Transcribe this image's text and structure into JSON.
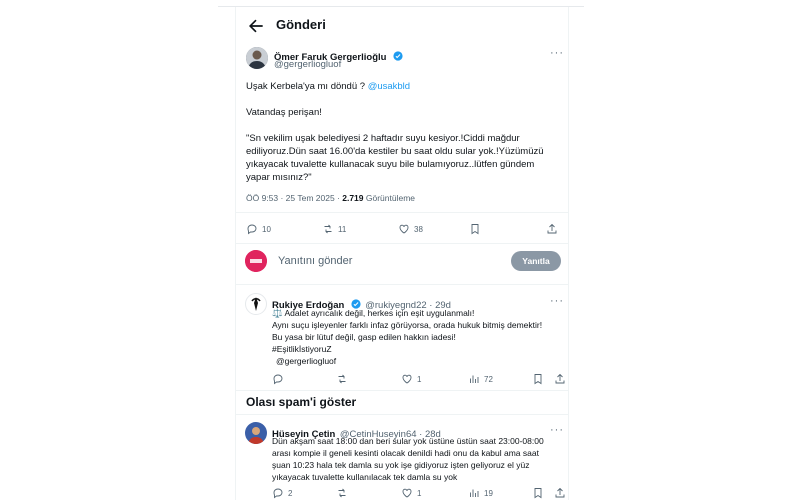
{
  "header": {
    "title": "Gönderi"
  },
  "tweet": {
    "author_name": "Ömer Faruk Gergerlioğlu",
    "author_handle": "@gergerliogluof",
    "line1_text": "Uşak Kerbela'ya mı döndü ? ",
    "line1_mention": "@usakbld",
    "line2": "Vatandaş perişan!",
    "quote_lines": [
      "\"Sn vekilim uşak belediyesi 2 haftadır suyu kesiyor.!Ciddi mağdur",
      "ediliyoruz.Dün saat 16.00'da kestiler bu saat oldu sular yok.!Yüzümüzü",
      "yıkayacak tuvalette kullanacak suyu bile bulamıyoruz..lütfen gündem",
      "yapar mısınız?\""
    ],
    "time": "ÖÖ 9:53 · 25 Tem 2025 · ",
    "views_count": "2.719",
    "views_label": " Görüntüleme",
    "stats": {
      "replies": "10",
      "retweets": "11",
      "likes": "38"
    }
  },
  "reply_box": {
    "placeholder": "Yanıtını gönder",
    "button": "Yanıtla"
  },
  "reply1": {
    "name": "Rukiye Erdoğan",
    "handle": "@rukiyegnd22 · 29d",
    "lines": [
      "⚖️ Adalet ayrıcalık değil, herkes için eşit uygulanmalı!",
      "Aynı suçu işleyenler farklı infaz görüyorsa, orada hukuk bitmiş demektir!",
      "Bu yasa bir lütuf değil, gasp edilen hakkın iadesi!"
    ],
    "hashtag": "#EşitlikİstiyoruZ",
    "mention": "@gergerliogluof",
    "stats": {
      "replies": "",
      "retweets": "",
      "likes": "1",
      "views": "72"
    }
  },
  "spam": {
    "title": "Olası spam'i göster"
  },
  "reply2": {
    "name": "Hüseyin Çetin",
    "handle": "@CetinHuseyin64 · 28d",
    "lines": [
      "Dün akşam saat 18:00 dan beri sular yok üstüne üstün saat 23:00-08:00",
      "arası kompie il geneli kesinti olacak denildi hadi onu da kabul ama saat",
      "şuan 10:23 hala tek damla su yok işe gidiyoruz işten geliyoruz el yüz",
      "yıkayacak tuvalette kullanılacak tek damla su yok"
    ],
    "stats": {
      "replies": "2",
      "retweets": "",
      "likes": "1",
      "views": "19"
    }
  }
}
